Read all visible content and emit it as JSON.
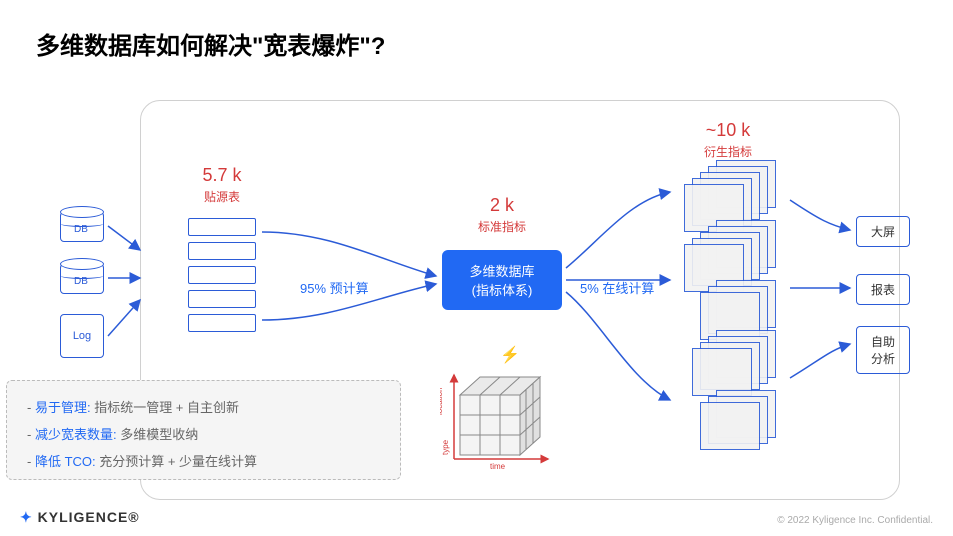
{
  "title": "多维数据库如何解决\"宽表爆炸\"?",
  "sources": {
    "db1": "DB",
    "db2": "DB",
    "log": "Log"
  },
  "stage1_label": {
    "big": "5.7 k",
    "small": "贴源表"
  },
  "flow1_label": "95% 预计算",
  "center_label": {
    "big": "2 k",
    "small": "标准指标"
  },
  "center_box": {
    "line1": "多维数据库",
    "line2": "(指标体系)"
  },
  "flow2_label": "5% 在线计算",
  "stage3_label": {
    "big": "~10 k",
    "small": "衍生指标"
  },
  "outputs": {
    "a": "大屏",
    "b": "报表",
    "c": "自助\n分析"
  },
  "benefits": {
    "row1_key": "易于管理:",
    "row1_val": " 指标统一管理 + 自主创新",
    "row2_key": "减少宽表数量:",
    "row2_val": " 多维模型收纳",
    "row3_key": "降低 TCO:",
    "row3_val": " 充分预计算 + 少量在线计算"
  },
  "bolt_icon": "⚡",
  "cube_axes": {
    "y": "location",
    "x": "time",
    "z": "type"
  },
  "footer": {
    "brand": "KYLIGENCE®",
    "copyright": "© 2022 Kyligence Inc. Confidential."
  }
}
